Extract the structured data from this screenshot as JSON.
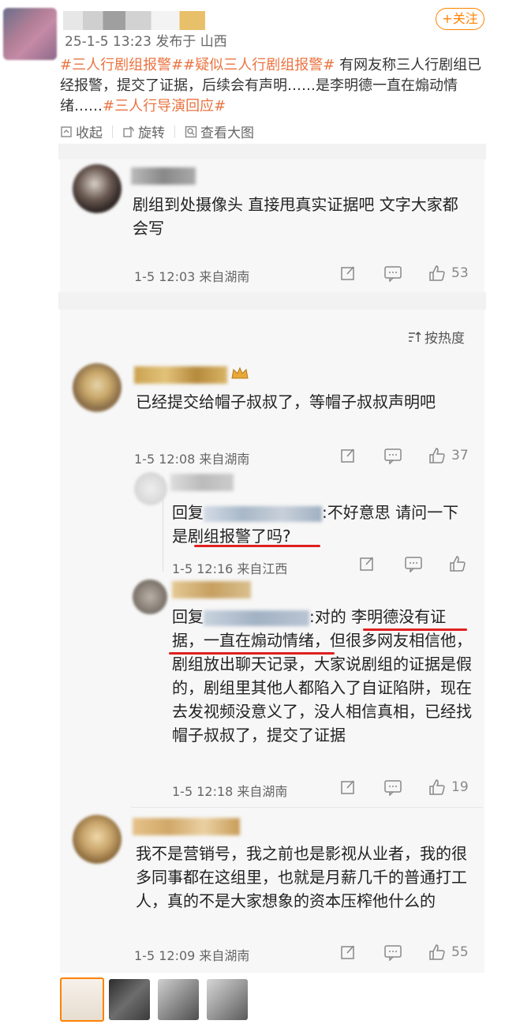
{
  "post": {
    "meta": "25-1-5 13:23 发布于 山西",
    "follow_label": "+关注",
    "tag1": "#三人行剧组报警#",
    "tag2": "#疑似三人行剧组报警#",
    "body": " 有网友称三人行剧组已经报警，提交了证据，后续会有声明……是李明德一直在煽动情绪……",
    "tag3": "#三人行导演回应#"
  },
  "actions": {
    "collect": "收起",
    "rotate": "旋转",
    "view_large": "查看大图"
  },
  "comment1": {
    "text": "剧组到处摄像头 直接甩真实证据吧 文字大家都会写",
    "meta": "1-5 12:03 来自湖南",
    "likes": "53"
  },
  "sort_label": "按热度",
  "comment2": {
    "text": "已经提交给帽子叔叔了，等帽子叔叔声明吧",
    "meta": "1-5 12:08 来自湖南",
    "likes": "37"
  },
  "reply1": {
    "prefix": "回复",
    "after_name": ":不好意思 请问一下是",
    "highlight": "剧组报警了吗?",
    "meta": "1-5 12:16 来自江西"
  },
  "reply2": {
    "prefix": "回复",
    "after_name": ":对的 ",
    "highlight": "李明德没有证据，一直在煽动情绪",
    "rest": "，但很多网友相信他，剧组放出聊天记录，大家说剧组的证据是假的，剧组里其他人都陷入了自证陷阱，现在去发视频没意义了，没人相信真相，已经找帽子叔叔了，提交了证据",
    "meta": "1-5 12:18 来自湖南",
    "likes": "19"
  },
  "comment3": {
    "text": "我不是营销号，我之前也是影视从业者，我的很多同事都在这组里，也就是月薪几千的普通打工人，真的不是大家想象的资本压榨他什么的",
    "meta": "1-5 12:09 来自湖南",
    "likes": "55"
  },
  "colors": {
    "accent": "#ff8200",
    "tag": "#eb7340",
    "underline": "#e02020"
  }
}
